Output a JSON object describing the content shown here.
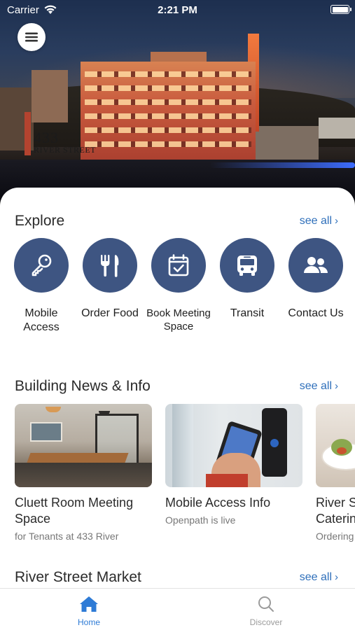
{
  "status_bar": {
    "carrier": "Carrier",
    "time": "2:21 PM"
  },
  "hero": {
    "logo_number": "433",
    "logo_street": "RIVER STREET"
  },
  "explore": {
    "title": "Explore",
    "see_all": "see all",
    "items": [
      {
        "label": "Mobile Access",
        "icon": "key-icon"
      },
      {
        "label": "Order Food",
        "icon": "utensils-icon"
      },
      {
        "label": "Book Meeting Space",
        "icon": "calendar-check-icon"
      },
      {
        "label": "Transit",
        "icon": "bus-icon"
      },
      {
        "label": "Contact Us",
        "icon": "users-icon"
      }
    ]
  },
  "news": {
    "title": "Building News & Info",
    "see_all": "see all",
    "cards": [
      {
        "title": "Cluett Room Meeting Space",
        "title_line1": "Cluett Room Meeting",
        "title_line2": "Space",
        "subtitle": "for Tenants at 433 River"
      },
      {
        "title": "Mobile Access Info",
        "subtitle": "Openpath is live"
      },
      {
        "title": "River Street Catering",
        "title_line1": "River S",
        "title_line2": "Caterin",
        "subtitle": "Ordering"
      }
    ]
  },
  "market": {
    "title": "River Street Market",
    "see_all": "see all"
  },
  "tabbar": {
    "tabs": [
      {
        "label": "Home",
        "icon": "home-icon",
        "active": true
      },
      {
        "label": "Discover",
        "icon": "search-icon",
        "active": false
      }
    ]
  },
  "colors": {
    "accent": "#3e5582",
    "link": "#2e6fba",
    "tab_active": "#2e7bd6",
    "tab_inactive": "#9b9b9b"
  }
}
